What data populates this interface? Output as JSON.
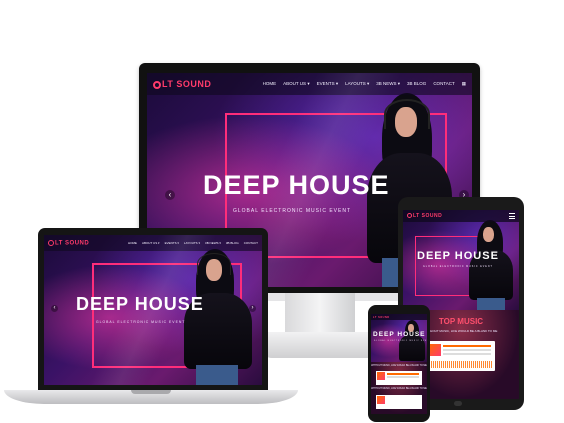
{
  "site": {
    "logo": "LT SOUND",
    "logo_short": "LT SOUND",
    "menu": [
      "HOME",
      "ABOUT US ▾",
      "EVENTS ▾",
      "LAYOUTS ▾",
      "3B NEWS ▾",
      "3B BLOG",
      "CONTACT"
    ],
    "menu_icon": "grid-icon"
  },
  "hero": {
    "title": "DEEP HOUSE",
    "subtitle": "GLOBAL ELECTRONIC MUSIC EVENT",
    "prev_label": "‹",
    "next_label": "›"
  },
  "tablet": {
    "section_title": "TOP MUSIC",
    "tagline": "WITHOUT MUSIC, LIFE WOULD BE A BLANK TO ME"
  },
  "phone": {
    "tagline": "WITHOUT MUSIC, LIFE WOULD BE A BLANK TO ME"
  },
  "colors": {
    "accent": "#ff3b6b",
    "frame": "#ff2d7a",
    "background_deep": "#1b0b3a"
  }
}
